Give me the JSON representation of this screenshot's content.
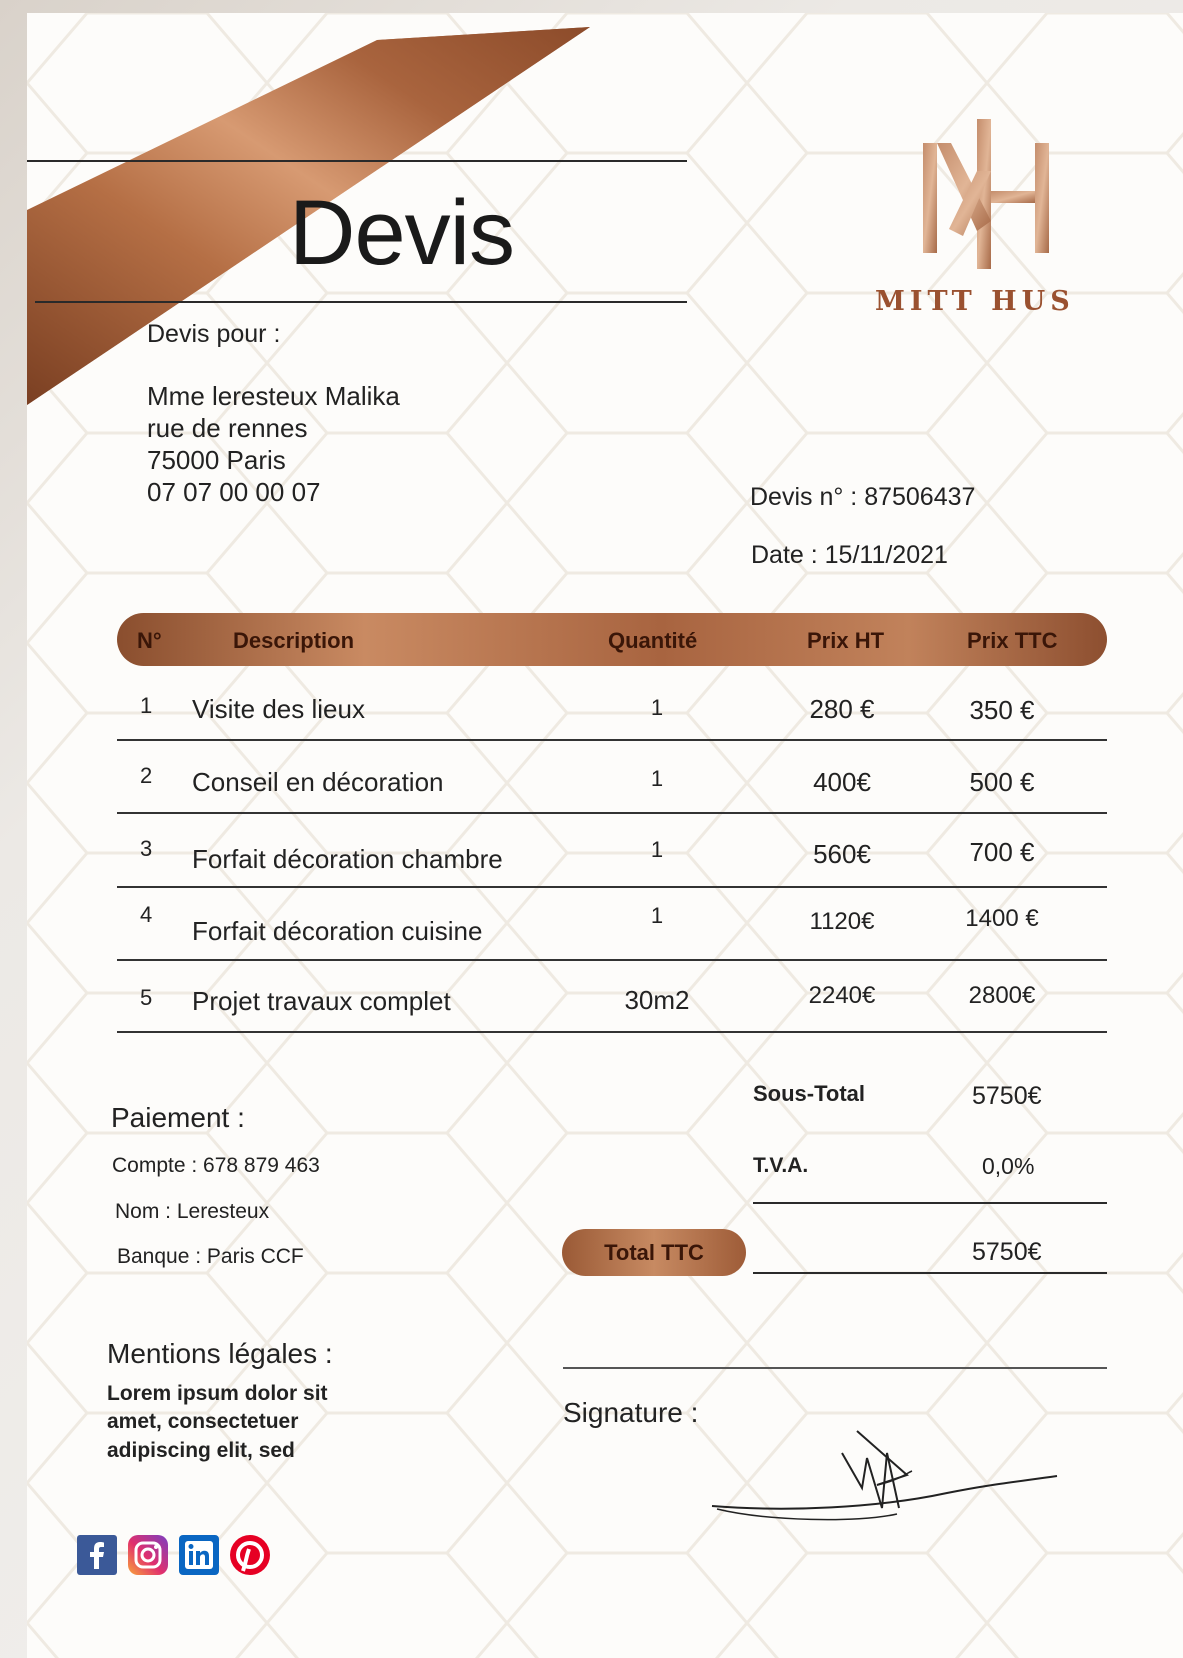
{
  "document": {
    "title": "Devis",
    "brand": "MITT HUS",
    "client": {
      "heading": "Devis pour :",
      "name": "Mme leresteux Malika",
      "street": "rue de rennes",
      "city": "75000 Paris",
      "phone": "07 07 00 00 07"
    },
    "quote_number": "Devis n° : 87506437",
    "date": "Date : 15/11/2021"
  },
  "table": {
    "columns": [
      "N°",
      "Description",
      "Quantité",
      "Prix HT",
      "Prix TTC"
    ],
    "rows": [
      {
        "n": "1",
        "description": "Visite des lieux",
        "qty": "1",
        "ht": "280 €",
        "ttc": "350 €"
      },
      {
        "n": "2",
        "description": "Conseil en décoration",
        "qty": "1",
        "ht": "400€",
        "ttc": "500 €"
      },
      {
        "n": "3",
        "description": "Forfait décoration chambre",
        "qty": "1",
        "ht": "560€",
        "ttc": "700 €"
      },
      {
        "n": "4",
        "description": "Forfait décoration cuisine",
        "qty": "1",
        "ht": "1120€",
        "ttc": "1400 €"
      },
      {
        "n": "5",
        "description": "Projet travaux complet",
        "qty": "30m2",
        "ht": "2240€",
        "ttc": "2800€"
      }
    ]
  },
  "totals": {
    "subtotal_label": "Sous-Total",
    "subtotal_value": "5750€",
    "tva_label": "T.V.A.",
    "tva_value": "0,0%",
    "total_label": "Total TTC",
    "total_value": "5750€"
  },
  "payment": {
    "heading": "Paiement :",
    "account": "Compte : 678 879 463",
    "name": "Nom : Leresteux",
    "bank": "Banque : Paris CCF"
  },
  "legal": {
    "heading": "Mentions légales :",
    "line1": "Lorem ipsum dolor sit",
    "line2": "amet, consectetuer",
    "line3": "adipiscing elit, sed"
  },
  "signature": {
    "label": "Signature :"
  },
  "social_icons": [
    "facebook-icon",
    "instagram-icon",
    "linkedin-icon",
    "pinterest-icon"
  ],
  "colors": {
    "copper": "#b06d46",
    "copper_dark": "#7d4528",
    "text": "#1e1e1e"
  }
}
